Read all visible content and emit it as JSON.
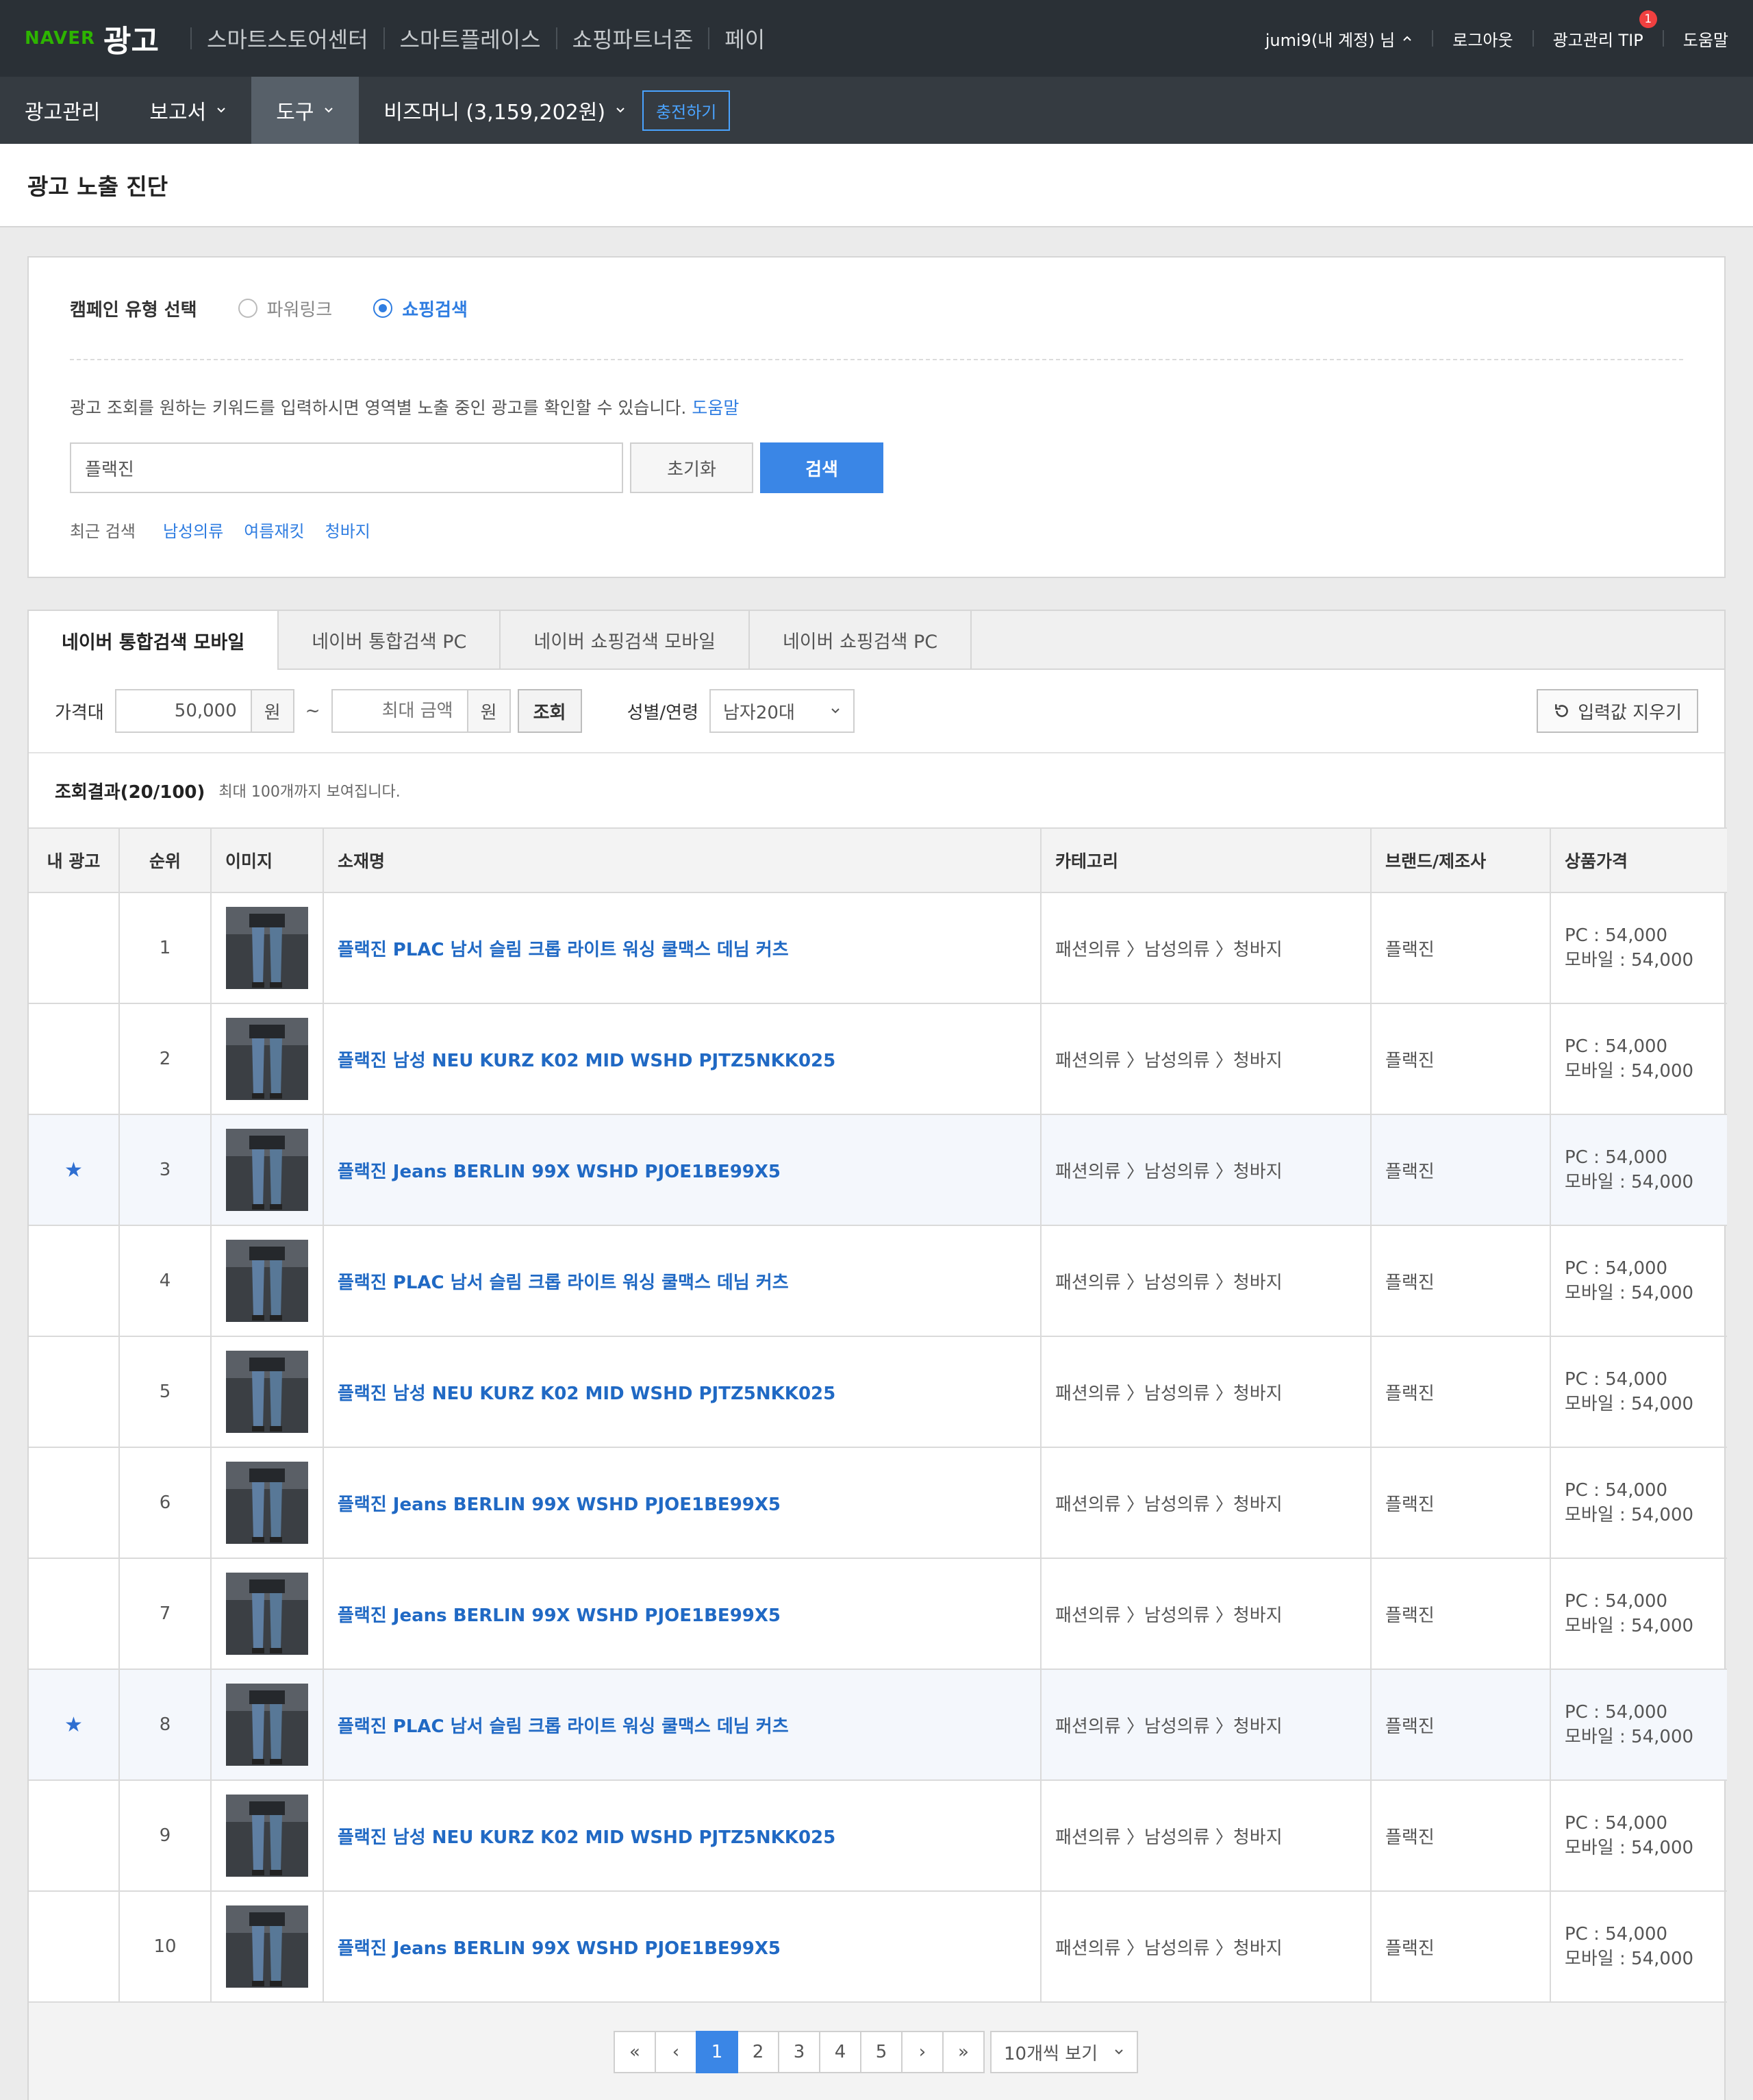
{
  "topbar": {
    "logo_naver": "NAVER",
    "logo_ad": "광고",
    "nav": [
      "스마트스토어센터",
      "스마트플레이스",
      "쇼핑파트너존",
      "페이"
    ],
    "user": "jumi9(내 계정) 님",
    "logout": "로그아웃",
    "tip": "광고관리 TIP",
    "tip_badge": "1",
    "help": "도움말"
  },
  "navbar": {
    "items": [
      "광고관리",
      "보고서",
      "도구",
      "비즈머니 (3,159,202원)"
    ],
    "charge": "충전하기"
  },
  "page_title": "광고 노출 진단",
  "search": {
    "campaign_label": "캠페인 유형 선택",
    "radio_powerlink": "파워링크",
    "radio_shopping": "쇼핑검색",
    "desc": "광고 조회를 원하는 키워드를 입력하시면 영역별 노출 중인 광고를 확인할 수 있습니다.",
    "help_link": "도움말",
    "keyword": "플랙진",
    "reset": "초기화",
    "search": "검색",
    "recent_label": "최근 검색",
    "recent": [
      "남성의류",
      "여름재킷",
      "청바지"
    ]
  },
  "tabs": [
    "네이버 통합검색 모바일",
    "네이버 통합검색 PC",
    "네이버 쇼핑검색 모바일",
    "네이버 쇼핑검색 PC"
  ],
  "filters": {
    "price_label": "가격대",
    "min_price": "50,000",
    "unit": "원",
    "tilde": "~",
    "max_placeholder": "최대 금액",
    "query": "조회",
    "gender_label": "성별/연령",
    "gender_value": "남자20대",
    "clear": "입력값 지우기"
  },
  "result": {
    "count": "조회결과(20/100)",
    "note": "최대 100개까지 보여집니다."
  },
  "table": {
    "headers": [
      "내 광고",
      "순위",
      "이미지",
      "소재명",
      "카테고리",
      "브랜드/제조사",
      "상품가격"
    ],
    "rows": [
      {
        "mine": "",
        "rank": "1",
        "name": "플랙진 PLAC 남서 슬림 크롭 라이트 워싱 쿨맥스 데님 커츠",
        "category": "패션의류 〉남성의류 〉청바지",
        "brand": "플랙진",
        "pc": "PC : 54,000",
        "mobile": "모바일 : 54,000"
      },
      {
        "mine": "",
        "rank": "2",
        "name": "플랙진 남성 NEU KURZ K02 MID WSHD PJTZ5NKK025",
        "category": "패션의류 〉남성의류 〉청바지",
        "brand": "플랙진",
        "pc": "PC : 54,000",
        "mobile": "모바일 : 54,000"
      },
      {
        "mine": "★",
        "rank": "3",
        "name": "플랙진 Jeans BERLIN 99X WSHD PJOE1BE99X5",
        "category": "패션의류 〉남성의류 〉청바지",
        "brand": "플랙진",
        "pc": "PC : 54,000",
        "mobile": "모바일 : 54,000"
      },
      {
        "mine": "",
        "rank": "4",
        "name": "플랙진 PLAC 남서 슬림 크롭 라이트 워싱 쿨맥스 데님 커츠",
        "category": "패션의류 〉남성의류 〉청바지",
        "brand": "플랙진",
        "pc": "PC : 54,000",
        "mobile": "모바일 : 54,000"
      },
      {
        "mine": "",
        "rank": "5",
        "name": "플랙진 남성 NEU KURZ K02 MID WSHD PJTZ5NKK025",
        "category": "패션의류 〉남성의류 〉청바지",
        "brand": "플랙진",
        "pc": "PC : 54,000",
        "mobile": "모바일 : 54,000"
      },
      {
        "mine": "",
        "rank": "6",
        "name": "플랙진 Jeans BERLIN 99X WSHD PJOE1BE99X5",
        "category": "패션의류 〉남성의류 〉청바지",
        "brand": "플랙진",
        "pc": "PC : 54,000",
        "mobile": "모바일 : 54,000"
      },
      {
        "mine": "",
        "rank": "7",
        "name": "플랙진 Jeans BERLIN 99X WSHD PJOE1BE99X5",
        "category": "패션의류 〉남성의류 〉청바지",
        "brand": "플랙진",
        "pc": "PC : 54,000",
        "mobile": "모바일 : 54,000"
      },
      {
        "mine": "★",
        "rank": "8",
        "name": "플랙진 PLAC 남서 슬림 크롭 라이트 워싱 쿨맥스 데님 커츠",
        "category": "패션의류 〉남성의류 〉청바지",
        "brand": "플랙진",
        "pc": "PC : 54,000",
        "mobile": "모바일 : 54,000"
      },
      {
        "mine": "",
        "rank": "9",
        "name": "플랙진 남성 NEU KURZ K02 MID WSHD PJTZ5NKK025",
        "category": "패션의류 〉남성의류 〉청바지",
        "brand": "플랙진",
        "pc": "PC : 54,000",
        "mobile": "모바일 : 54,000"
      },
      {
        "mine": "",
        "rank": "10",
        "name": "플랙진 Jeans BERLIN 99X WSHD PJOE1BE99X5",
        "category": "패션의류 〉남성의류 〉청바지",
        "brand": "플랙진",
        "pc": "PC : 54,000",
        "mobile": "모바일 : 54,000"
      }
    ]
  },
  "pager": {
    "first": "«",
    "prev": "‹",
    "pages": [
      "1",
      "2",
      "3",
      "4",
      "5"
    ],
    "next": "›",
    "last": "»",
    "page_size": "10개씩 보기"
  },
  "colors": {
    "topbar": "#2a3036",
    "navbar": "#353b41",
    "accent": "#3a86e6",
    "link": "#2069c4",
    "naver_green": "#2db400"
  }
}
